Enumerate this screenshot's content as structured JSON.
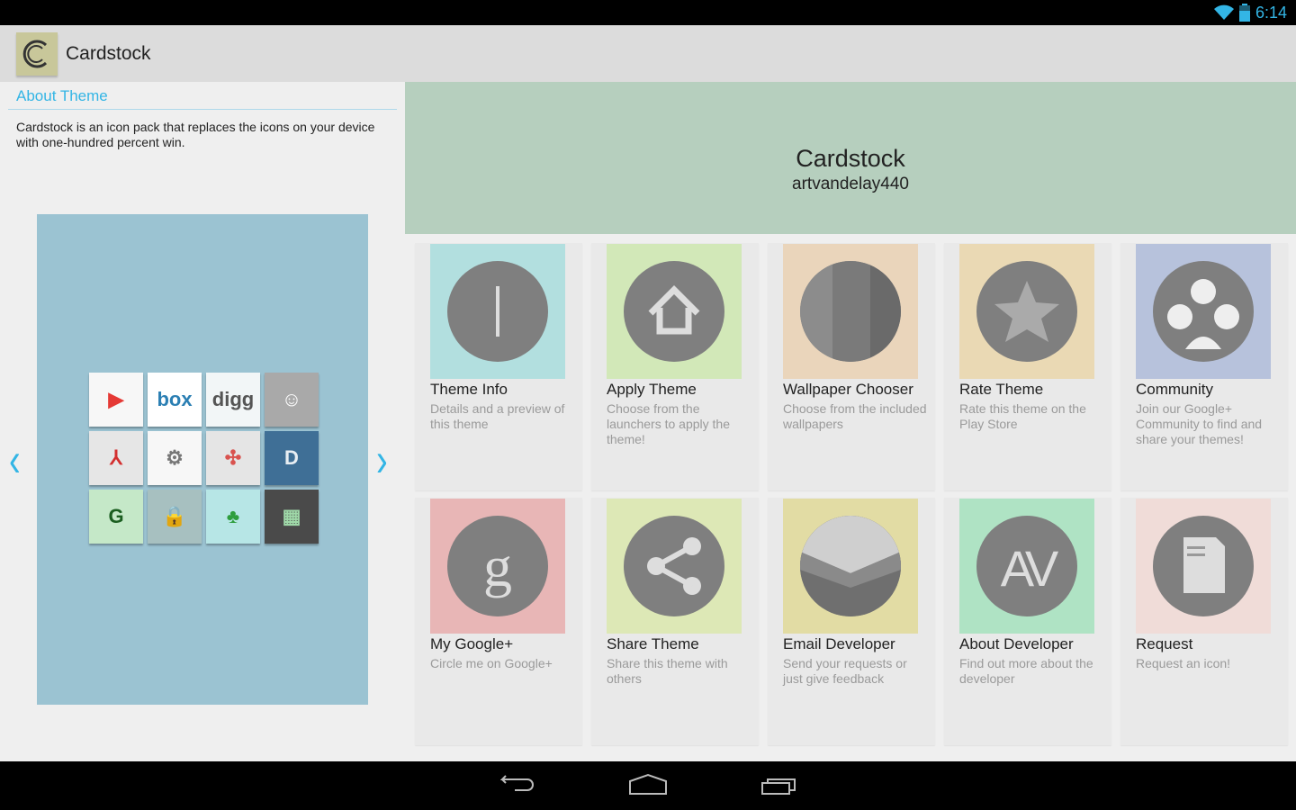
{
  "status": {
    "time": "6:14"
  },
  "app": {
    "title": "Cardstock"
  },
  "about": {
    "heading": "About Theme",
    "text": "Cardstock is an icon pack that replaces the icons on your device with one-hundred percent win."
  },
  "preview": {
    "tiles": [
      {
        "name": "play",
        "bg": "#f7f7f7",
        "fg": "#e53935",
        "glyph": "▶"
      },
      {
        "name": "box",
        "bg": "#ffffff",
        "fg": "#2b7fb3",
        "glyph": "box"
      },
      {
        "name": "digg",
        "bg": "#f2f6f7",
        "fg": "#555555",
        "glyph": "digg"
      },
      {
        "name": "chat",
        "bg": "#a9a9a9",
        "fg": "#ffffff",
        "glyph": "☺"
      },
      {
        "name": "acrobat",
        "bg": "#e6e6e6",
        "fg": "#d32f2f",
        "glyph": "⅄"
      },
      {
        "name": "settings",
        "bg": "#f7f7f7",
        "fg": "#777777",
        "glyph": "⚙"
      },
      {
        "name": "air",
        "bg": "#e5e5e5",
        "fg": "#d9534f",
        "glyph": "✣"
      },
      {
        "name": "dictionary",
        "bg": "#3f6f96",
        "fg": "#e8eef3",
        "glyph": "D"
      },
      {
        "name": "grammar",
        "bg": "#c5e8c8",
        "fg": "#1b5e20",
        "glyph": "G"
      },
      {
        "name": "lock-mail",
        "bg": "#a7c0c0",
        "fg": "#eeeeee",
        "glyph": "🔒"
      },
      {
        "name": "tree",
        "bg": "#b7e6e6",
        "fg": "#2e9e3e",
        "glyph": "♣"
      },
      {
        "name": "blocks",
        "bg": "#4a4a4a",
        "fg": "#9fd8a8",
        "glyph": "▦"
      }
    ]
  },
  "hero": {
    "title": "Cardstock",
    "subtitle": "artvandelay440"
  },
  "cards": [
    {
      "title": "Theme Info",
      "desc": "Details and a preview of this theme",
      "bg": "#b2dfdf",
      "icon": "info"
    },
    {
      "title": "Apply Theme",
      "desc": "Choose from the launchers to apply the theme!",
      "bg": "#d2e8b8",
      "icon": "home"
    },
    {
      "title": "Wallpaper Chooser",
      "desc": "Choose from the included wallpapers",
      "bg": "#ead5bb",
      "icon": "wallpaper"
    },
    {
      "title": "Rate Theme",
      "desc": "Rate this theme on the Play Store",
      "bg": "#ead9b4",
      "icon": "star"
    },
    {
      "title": "Community",
      "desc": "Join our Google+ Community to find and share your themes!",
      "bg": "#b7c2dc",
      "icon": "community"
    },
    {
      "title": "My Google+",
      "desc": "Circle me on Google+",
      "bg": "#e8b6b6",
      "icon": "google"
    },
    {
      "title": "Share Theme",
      "desc": "Share this theme with others",
      "bg": "#dde8b6",
      "icon": "share"
    },
    {
      "title": "Email Developer",
      "desc": "Send your requests or just give feedback",
      "bg": "#e2dca4",
      "icon": "email"
    },
    {
      "title": "About Developer",
      "desc": "Find out more about the developer",
      "bg": "#afe3c4",
      "icon": "av"
    },
    {
      "title": "Request",
      "desc": "Request an icon!",
      "bg": "#f0dcd8",
      "icon": "document"
    }
  ],
  "colors": {
    "accent": "#33b5e5"
  }
}
